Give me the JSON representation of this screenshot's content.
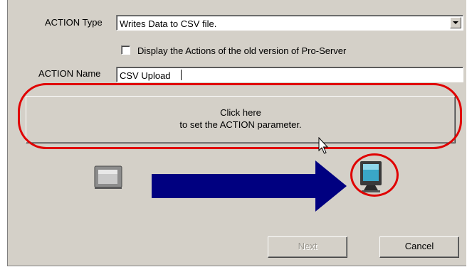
{
  "action_type": {
    "label": "ACTION Type",
    "selected_value": "Writes Data to CSV file."
  },
  "old_version_checkbox": {
    "label": "Display the Actions of the old version of Pro-Server",
    "checked": false
  },
  "action_name": {
    "label": "ACTION Name",
    "value": "CSV Upload"
  },
  "set_parameter_button": {
    "line1": "Click here",
    "line2": "to set the ACTION parameter."
  },
  "flow": {
    "source_icon": "display-panel-icon",
    "arrow_icon": "right-arrow-icon",
    "target_icon": "pc-monitor-icon",
    "arrow_color": "#000080",
    "highlight_color": "#e00000"
  },
  "buttons": {
    "next_label": "Next",
    "next_enabled": false,
    "cancel_label": "Cancel"
  }
}
